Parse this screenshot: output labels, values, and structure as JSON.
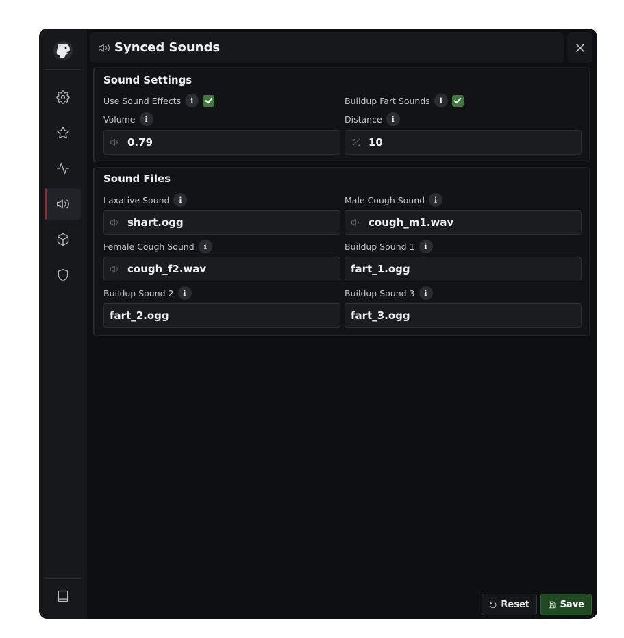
{
  "header": {
    "title": "Synced Sounds",
    "title_icon": "speaker-icon",
    "close_icon": "close-icon"
  },
  "sidebar": {
    "logo": "polar-bear-logo",
    "items": [
      {
        "icon": "gear-icon",
        "active": false
      },
      {
        "icon": "star-icon",
        "active": false
      },
      {
        "icon": "activity-icon",
        "active": false
      },
      {
        "icon": "speaker-icon",
        "active": true
      },
      {
        "icon": "cube-icon",
        "active": false
      },
      {
        "icon": "shield-icon",
        "active": false
      }
    ],
    "bottom_item": {
      "icon": "book-icon"
    },
    "active_accent": "#a0222a"
  },
  "sound_settings": {
    "title": "Sound Settings",
    "use_sound_effects": {
      "label": "Use Sound Effects",
      "checked": true
    },
    "buildup_fart_sounds": {
      "label": "Buildup Fart Sounds",
      "checked": true
    },
    "volume": {
      "label": "Volume",
      "value": "0.79",
      "icon": "speaker-icon"
    },
    "distance": {
      "label": "Distance",
      "value": "10",
      "icon": "percent-icon"
    }
  },
  "sound_files": {
    "title": "Sound Files",
    "laxative": {
      "label": "Laxative Sound",
      "value": "shart.ogg",
      "icon": "speaker-icon"
    },
    "male_cough": {
      "label": "Male Cough Sound",
      "value": "cough_m1.wav",
      "icon": "speaker-icon"
    },
    "female_cough": {
      "label": "Female Cough Sound",
      "value": "cough_f2.wav",
      "icon": "speaker-icon"
    },
    "buildup1": {
      "label": "Buildup Sound 1",
      "value": "fart_1.ogg"
    },
    "buildup2": {
      "label": "Buildup Sound 2",
      "value": "fart_2.ogg"
    },
    "buildup3": {
      "label": "Buildup Sound 3",
      "value": "fart_3.ogg"
    }
  },
  "info_badge": "i",
  "footer": {
    "reset_label": "Reset",
    "save_label": "Save",
    "reset_icon": "undo-icon",
    "save_icon": "floppy-icon",
    "save_color": "#1f4a22"
  },
  "colors": {
    "background": "#0e0f11",
    "panel": "#17181b",
    "checkbox": "#3d7a3d"
  }
}
